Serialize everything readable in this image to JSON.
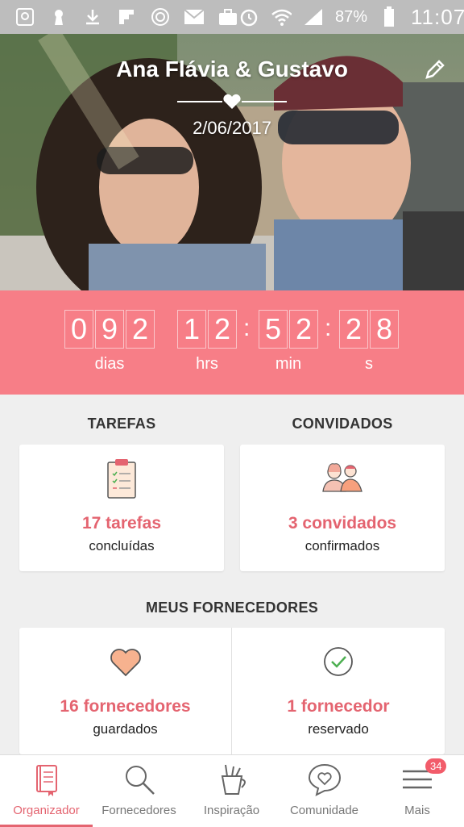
{
  "statusbar": {
    "battery": "87%",
    "time": "11:07",
    "icons": [
      "pocket-icon",
      "keyhole-icon",
      "download-icon",
      "flipboard-icon",
      "badge-icon",
      "mail-icon",
      "briefcase-icon",
      "alarm-icon",
      "wifi-icon",
      "signal-icon",
      "battery-icon"
    ]
  },
  "hero": {
    "title": "Ana Flávia & Gustavo",
    "date": "2/06/2017"
  },
  "countdown": {
    "days_digits": [
      "0",
      "9",
      "2"
    ],
    "hours_digits": [
      "1",
      "2"
    ],
    "minutes_digits": [
      "5",
      "2"
    ],
    "seconds_digits": [
      "2",
      "8"
    ],
    "labels": {
      "days": "dias",
      "hours": "hrs",
      "minutes": "min",
      "seconds": "s"
    }
  },
  "sections": {
    "tarefas": {
      "title": "TAREFAS",
      "main": "17 tarefas",
      "sub": "concluídas"
    },
    "convidados": {
      "title": "CONVIDADOS",
      "main": "3 convidados",
      "sub": "confirmados"
    },
    "fornecedores": {
      "title": "MEUS FORNECEDORES",
      "saved_main": "16 fornecedores",
      "saved_sub": "guardados",
      "reserved_main": "1 fornecedor",
      "reserved_sub": "reservado"
    }
  },
  "nav": {
    "items": [
      {
        "label": "Organizador",
        "icon": "notebook-icon",
        "active": true
      },
      {
        "label": "Fornecedores",
        "icon": "search-icon"
      },
      {
        "label": "Inspiração",
        "icon": "inspiration-cup-icon"
      },
      {
        "label": "Comunidade",
        "icon": "chat-heart-icon"
      },
      {
        "label": "Mais",
        "icon": "menu-icon"
      }
    ],
    "badge": "34"
  },
  "colors": {
    "accent": "#f77e87",
    "text_accent": "#e46470",
    "statusbar": "#bdbdbd"
  }
}
